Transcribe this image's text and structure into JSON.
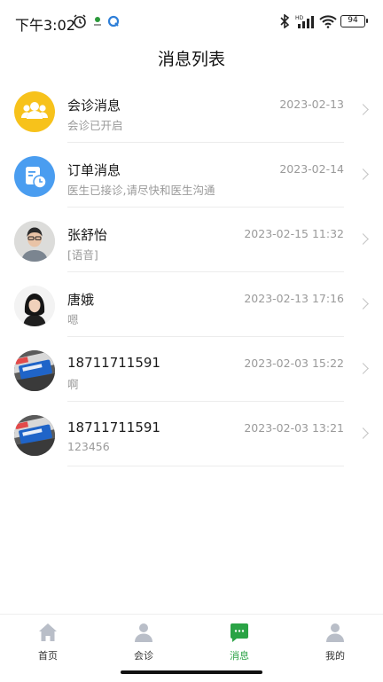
{
  "status_bar": {
    "time": "下午3:02",
    "battery": "94",
    "network_label": "HD"
  },
  "page": {
    "title": "消息列表"
  },
  "messages": [
    {
      "name": "会诊消息",
      "preview": "会诊已开启",
      "time": "2023-02-13",
      "avatar": "consult-group-icon",
      "avatar_color": "#f7c21b"
    },
    {
      "name": "订单消息",
      "preview": "医生已接诊,请尽快和医生沟通",
      "time": "2023-02-14",
      "avatar": "order-clock-icon",
      "avatar_color": "#4a9df0"
    },
    {
      "name": "张舒怡",
      "preview": "[语音]",
      "time": "2023-02-15 11:32",
      "avatar": "user-photo"
    },
    {
      "name": "唐娥",
      "preview": "嗯",
      "time": "2023-02-13 17:16",
      "avatar": "user-photo"
    },
    {
      "name": "18711711591",
      "preview": "啊",
      "time": "2023-02-03 15:22",
      "avatar": "user-photo"
    },
    {
      "name": "18711711591",
      "preview": "123456",
      "time": "2023-02-03 13:21",
      "avatar": "user-photo"
    }
  ],
  "tabs": [
    {
      "label": "首页",
      "icon": "home-icon",
      "active": false
    },
    {
      "label": "会诊",
      "icon": "person-icon",
      "active": false
    },
    {
      "label": "消息",
      "icon": "chat-icon",
      "active": true
    },
    {
      "label": "我的",
      "icon": "profile-icon",
      "active": false
    }
  ],
  "colors": {
    "accent": "#2aa345",
    "inactive_icon": "#b9bec8"
  }
}
